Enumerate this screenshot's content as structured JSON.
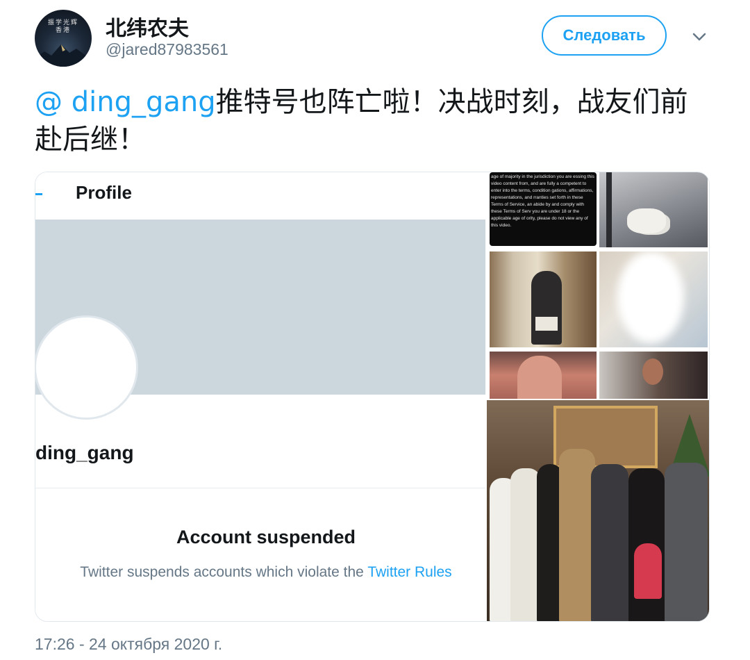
{
  "tweet": {
    "author": {
      "display_name": "北纬农夫",
      "handle": "@jared87983561",
      "avatar_text": "振学光辉香港"
    },
    "follow_label": "Следовать",
    "text_mention": "@ ding_gang",
    "text_body": "推特号也阵亡啦！决战时刻，战友们前赴后继！",
    "timestamp": "17:26 - 24 октября 2020 г."
  },
  "media": {
    "profile_screenshot": {
      "title": "Profile",
      "username": "ding_gang",
      "suspended_title": "Account suspended",
      "suspended_desc": "Twitter suspends accounts which violate the",
      "rules_link": "Twitter Rules"
    },
    "collage_text_tile": "age of majority in the jurisdiction you are essing this video content from, and are fully a competent to enter into the terms, condition gations, affirmations, representations, and rranties set forth in these Terms of Service, an abide by and comply with these Terms of Serv you are under 18 or the applicable age of ority, please do not view any of this video."
  },
  "colors": {
    "accent": "#1da1f2",
    "text": "#14171a",
    "muted": "#657786",
    "banner": "#ccd6dd"
  },
  "icons": {
    "more": "chevron-down-icon"
  }
}
